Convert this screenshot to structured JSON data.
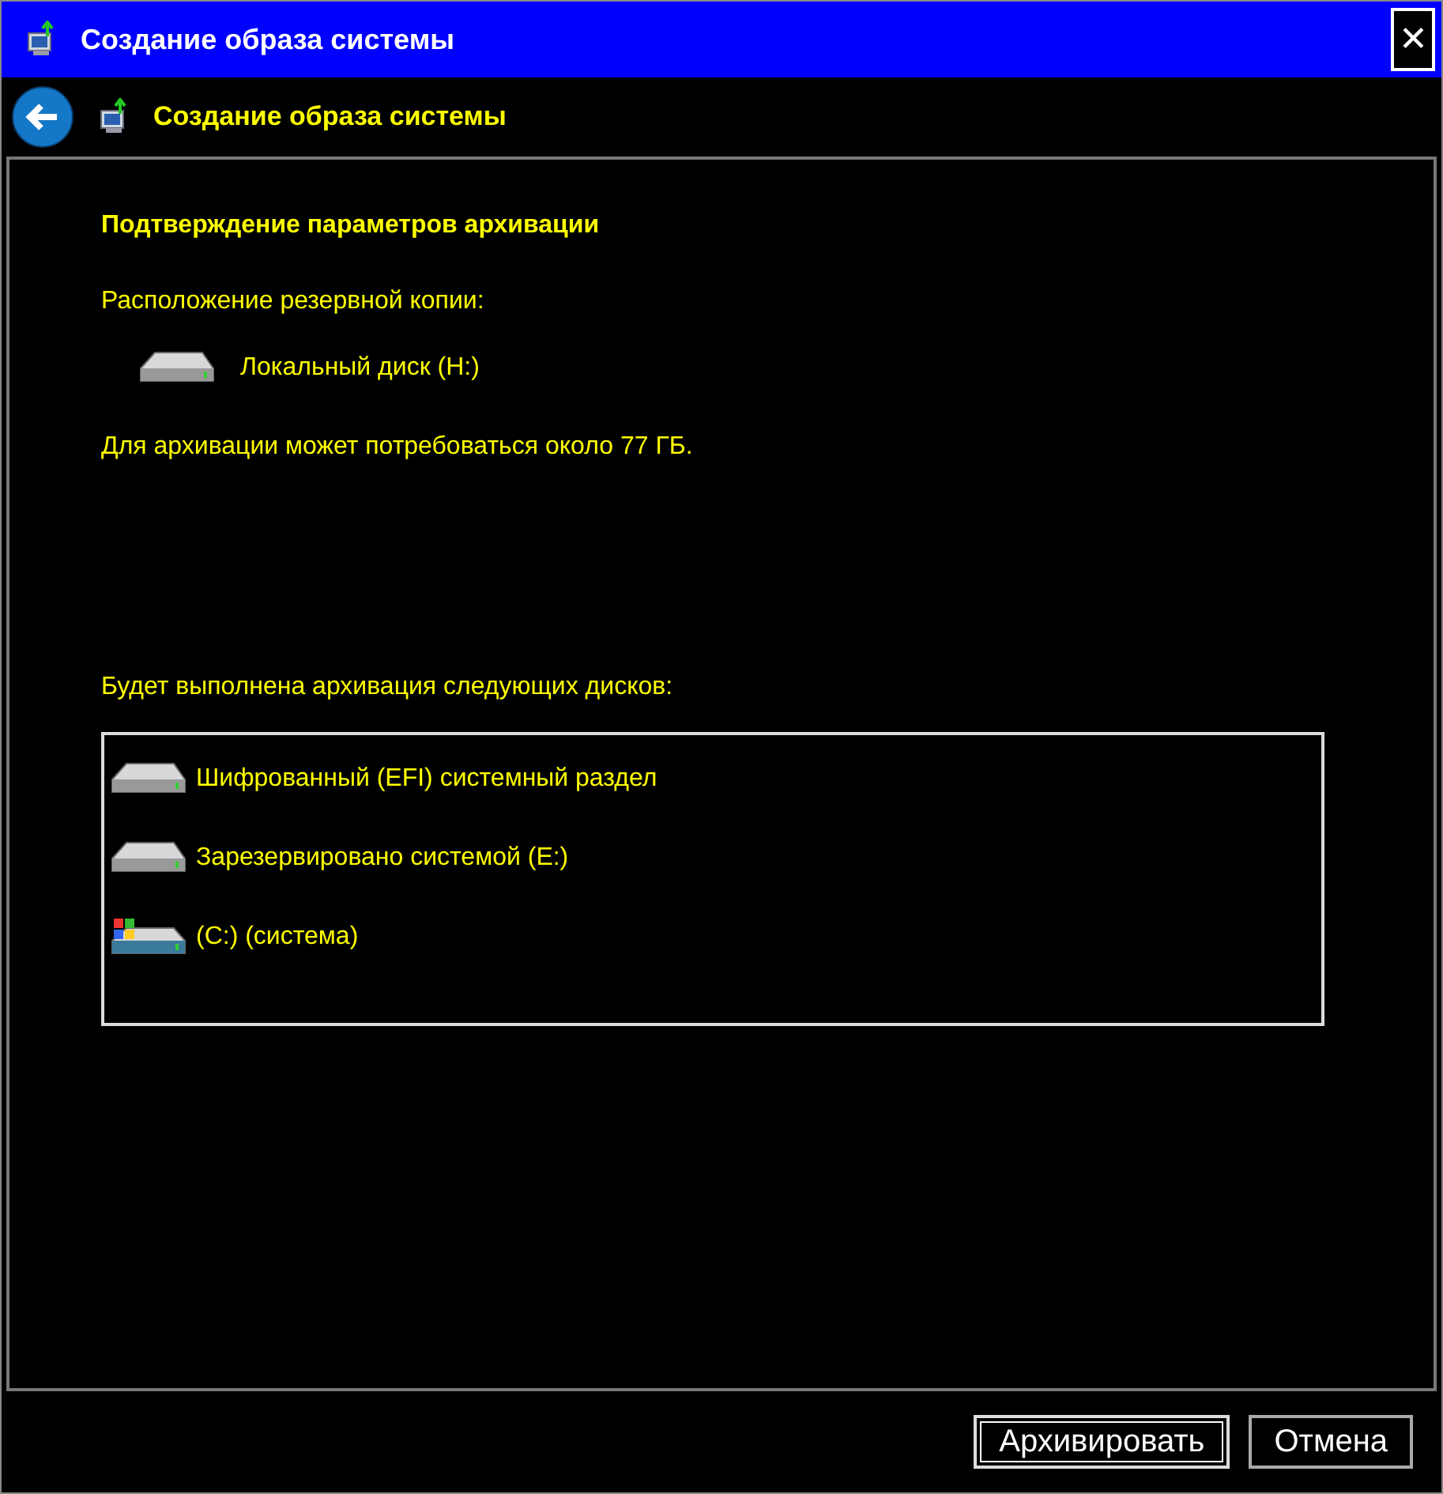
{
  "window": {
    "title": "Создание образа системы",
    "close": "✕"
  },
  "nav": {
    "title": "Создание образа системы"
  },
  "heading": "Подтверждение параметров архивации",
  "location_label": "Расположение резервной копии:",
  "location": {
    "kind": "disk",
    "label": "Локальный диск (H:)"
  },
  "size_note": "Для архивации может потребоваться около 77 ГБ.",
  "disks_label": "Будет выполнена архивация следующих дисков:",
  "disks": [
    {
      "kind": "disk",
      "label": "Шифрованный (EFI) системный раздел"
    },
    {
      "kind": "disk",
      "label": "Зарезервировано системой (E:)"
    },
    {
      "kind": "system",
      "label": "(C:) (система)"
    }
  ],
  "buttons": [
    {
      "label": "Архивировать",
      "default": true
    },
    {
      "label": "Отмена",
      "default": false
    }
  ]
}
